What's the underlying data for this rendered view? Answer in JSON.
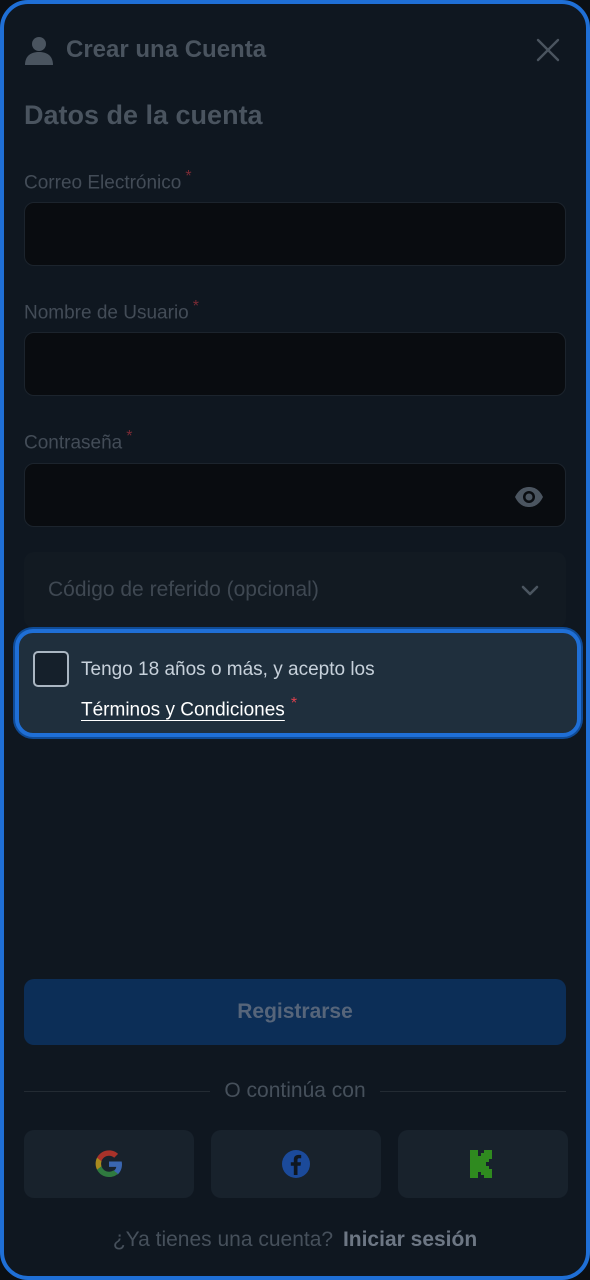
{
  "header": {
    "title": "Crear una Cuenta",
    "user_icon": "user-icon",
    "close_icon": "close-icon"
  },
  "section": {
    "title": "Datos de la cuenta"
  },
  "fields": {
    "email": {
      "label": "Correo Electrónico",
      "required_mark": "*",
      "value": ""
    },
    "username": {
      "label": "Nombre de Usuario",
      "required_mark": "*",
      "value": ""
    },
    "password": {
      "label": "Contraseña",
      "required_mark": "*",
      "value": "",
      "toggle_icon": "eye-icon"
    }
  },
  "referral": {
    "label": "Código de referido (opcional)",
    "icon": "chevron-down-icon"
  },
  "consent": {
    "text": "Tengo 18 años o más, y acepto los",
    "link": "Términos y Condiciones",
    "required_mark": "*",
    "checked": false
  },
  "register_button": "Registrarse",
  "divider_text": "O continúa con",
  "social": {
    "google_icon": "google-icon",
    "facebook_icon": "facebook-icon",
    "kick_icon": "kick-icon"
  },
  "footer": {
    "question": "¿Ya tienes una cuenta?",
    "login_link": "Iniciar sesión"
  },
  "colors": {
    "accent": "#1f6fd6",
    "background": "#0f1720",
    "register_button": "#0c2e57",
    "consent_bg": "#1f2f3d",
    "required": "#e0414e"
  }
}
